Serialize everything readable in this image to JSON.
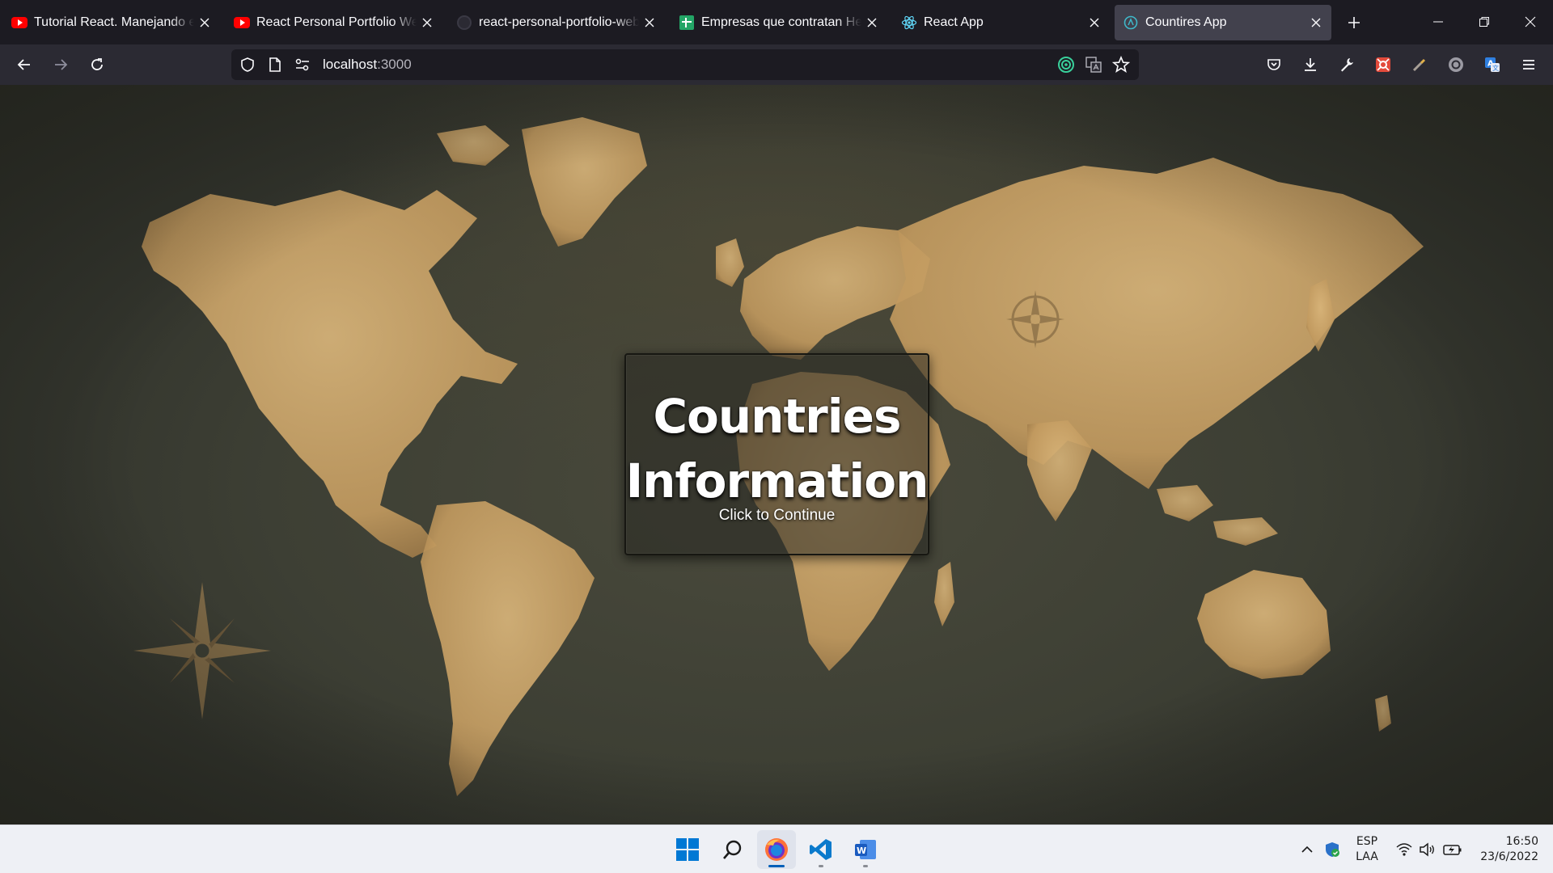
{
  "browser": {
    "tabs": [
      {
        "title": "Tutorial React. Manejando el e",
        "favicon": "youtube-icon",
        "active": false
      },
      {
        "title": "React Personal Portfolio Websi",
        "favicon": "youtube-icon",
        "active": false
      },
      {
        "title": "react-personal-portfolio-webs",
        "favicon": "github-icon",
        "active": false
      },
      {
        "title": "Empresas que contratan Henry",
        "favicon": "google-sheets-icon",
        "active": false
      },
      {
        "title": "React App",
        "favicon": "react-icon",
        "active": false
      },
      {
        "title": "Countires App",
        "favicon": "app-favicon-icon",
        "active": true
      }
    ],
    "url": {
      "host": "localhost",
      "port": ":3000"
    }
  },
  "page": {
    "title_line1": "Countries",
    "title_line2": "Information",
    "subtitle": "Click to Continue"
  },
  "taskbar": {
    "apps": [
      "start-icon",
      "search-icon",
      "firefox-icon",
      "vscode-icon",
      "word-icon"
    ],
    "language": "ESP",
    "layout": "LAA",
    "time": "16:50",
    "date": "23/6/2022"
  },
  "colors": {
    "tab_bg": "#1c1b22",
    "nav_bg": "#2b2a33",
    "active_tab": "#42414d",
    "map_land": "#c9a46b",
    "map_ocean": "#3d3f34",
    "taskbar_bg": "#eef0f5"
  }
}
